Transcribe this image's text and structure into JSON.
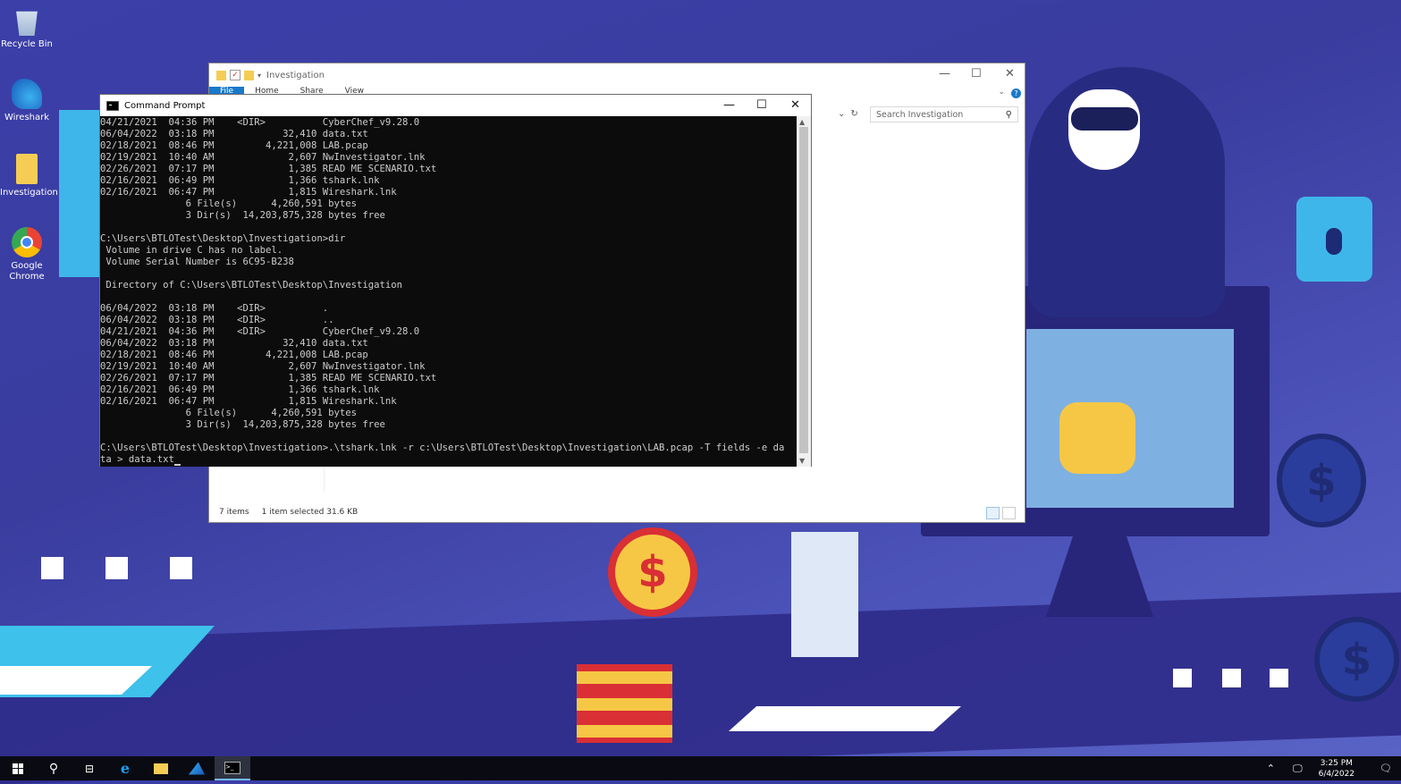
{
  "desktop": {
    "icons": [
      {
        "label": "Recycle Bin",
        "icon": "recycle-bin-icon"
      },
      {
        "label": "Wireshark",
        "icon": "wireshark-icon"
      },
      {
        "label": "Investigation",
        "icon": "folder-icon"
      },
      {
        "label": "Google Chrome",
        "icon": "chrome-icon"
      }
    ]
  },
  "explorer": {
    "title": "Investigation",
    "tabs": [
      "File",
      "Home",
      "Share",
      "View"
    ],
    "search_placeholder": "Search Investigation",
    "status": {
      "items": "7 items",
      "selection": "1 item selected  31.6 KB"
    }
  },
  "cmd": {
    "title": "Command Prompt",
    "lines": [
      "04/21/2021  04:36 PM    <DIR>          CyberChef_v9.28.0",
      "06/04/2022  03:18 PM            32,410 data.txt",
      "02/18/2021  08:46 PM         4,221,008 LAB.pcap",
      "02/19/2021  10:40 AM             2,607 NwInvestigator.lnk",
      "02/26/2021  07:17 PM             1,385 READ ME SCENARIO.txt",
      "02/16/2021  06:49 PM             1,366 tshark.lnk",
      "02/16/2021  06:47 PM             1,815 Wireshark.lnk",
      "               6 File(s)      4,260,591 bytes",
      "               3 Dir(s)  14,203,875,328 bytes free",
      "",
      "C:\\Users\\BTLOTest\\Desktop\\Investigation>dir",
      " Volume in drive C has no label.",
      " Volume Serial Number is 6C95-B238",
      "",
      " Directory of C:\\Users\\BTLOTest\\Desktop\\Investigation",
      "",
      "06/04/2022  03:18 PM    <DIR>          .",
      "06/04/2022  03:18 PM    <DIR>          ..",
      "04/21/2021  04:36 PM    <DIR>          CyberChef_v9.28.0",
      "06/04/2022  03:18 PM            32,410 data.txt",
      "02/18/2021  08:46 PM         4,221,008 LAB.pcap",
      "02/19/2021  10:40 AM             2,607 NwInvestigator.lnk",
      "02/26/2021  07:17 PM             1,385 READ ME SCENARIO.txt",
      "02/16/2021  06:49 PM             1,366 tshark.lnk",
      "02/16/2021  06:47 PM             1,815 Wireshark.lnk",
      "               6 File(s)      4,260,591 bytes",
      "               3 Dir(s)  14,203,875,328 bytes free",
      "",
      "C:\\Users\\BTLOTest\\Desktop\\Investigation>.\\tshark.lnk -r c:\\Users\\BTLOTest\\Desktop\\Investigation\\LAB.pcap -T fields -e da",
      "ta > data.txt"
    ]
  },
  "taskbar": {
    "items": [
      "start-icon",
      "search-icon",
      "task-view-icon",
      "internet-explorer-icon",
      "file-explorer-icon",
      "wireshark-icon",
      "command-prompt-icon"
    ],
    "clock": {
      "time": "3:25 PM",
      "date": "6/4/2022"
    }
  },
  "colors": {
    "terminal_bg": "#0c0c0c",
    "terminal_fg": "#cccccc",
    "accent": "#1979ca",
    "taskbar": "#0a0b12"
  }
}
